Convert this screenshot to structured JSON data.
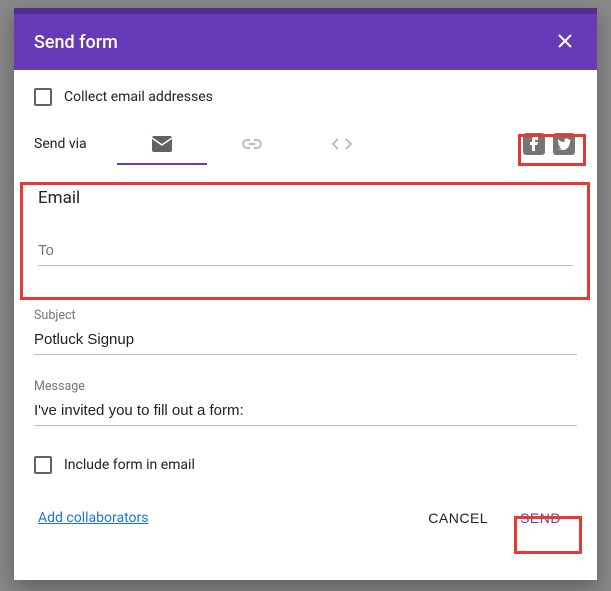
{
  "header": {
    "title": "Send form"
  },
  "collect": {
    "label": "Collect email addresses"
  },
  "sendvia": {
    "label": "Send via"
  },
  "email": {
    "heading": "Email",
    "to_placeholder": "To",
    "subject_label": "Subject",
    "subject_value": "Potluck Signup",
    "message_label": "Message",
    "message_value": "I've invited you to fill out a form:",
    "include_label": "Include form in email"
  },
  "footer": {
    "add_collaborators": "Add collaborators",
    "cancel": "Cancel",
    "send": "Send"
  }
}
